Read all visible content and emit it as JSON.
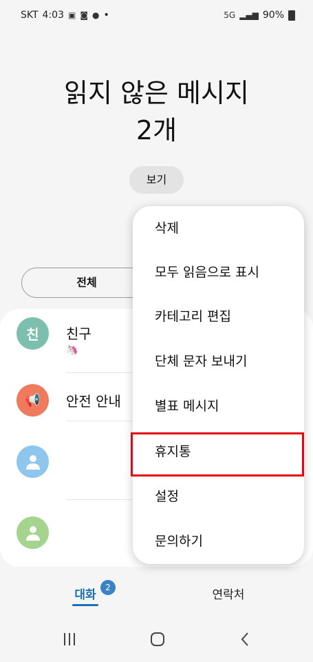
{
  "status": {
    "carrier": "SKT",
    "time": "4:03",
    "battery": "90%",
    "network": "5G"
  },
  "header": {
    "line1": "읽지 않은 메시지",
    "line2": "2개"
  },
  "view_button": "보기",
  "filter": {
    "all_label": "전체"
  },
  "conversations": [
    {
      "title": "친구",
      "avatar_text": "친",
      "avatar_color": "#7dbfae",
      "sub": "🦄"
    },
    {
      "title": "안전 안내",
      "avatar_text": "📢",
      "avatar_color": "#ef7a5d",
      "sub": ""
    },
    {
      "title": "",
      "avatar_text": "",
      "avatar_color": "#8ec6ee",
      "sub": ""
    },
    {
      "title": "",
      "avatar_text": "",
      "avatar_color": "#a4d48e",
      "sub": ""
    }
  ],
  "menu": {
    "items": [
      "삭제",
      "모두 읽음으로 표시",
      "카테고리 편집",
      "단체 문자 보내기",
      "별표 메시지",
      "휴지통",
      "설정",
      "문의하기"
    ],
    "highlighted": "휴지통"
  },
  "tabs": {
    "conversations": "대화",
    "conversations_badge": "2",
    "contacts": "연락처"
  },
  "colors": {
    "accent": "#1a6fb5",
    "highlight_border": "#e4050f",
    "badge": "#3b82c4"
  }
}
